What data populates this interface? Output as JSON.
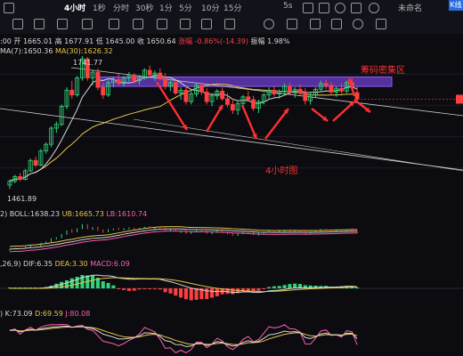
{
  "toolbar": {
    "timeframes": [
      "4小时",
      "1秒",
      "分时",
      "30秒",
      "1分",
      "5分",
      "10分",
      "15分"
    ],
    "active_timeframe": "4小时",
    "refresh_label": "5s",
    "account_label": "未命名",
    "k_label": "K线"
  },
  "ohlc_row": {
    "open_text": ":00 开 1665.01",
    "high_text": "高 1677.91",
    "low_text": "低 1645.00",
    "close_text": "收 1650.64",
    "change_text": "涨幅 -0.86%(-14.39)",
    "amplitude_text": "振幅 1.98%"
  },
  "ma_row": {
    "ma7_text": "MA(7):1650.36",
    "ma30_text": "MA(30):1626.32"
  },
  "boll_row": {
    "prefix": "2)",
    "boll_text": "BOLL:1638.23",
    "ub_text": "UB:1665.73",
    "lb_text": "LB:1610.74"
  },
  "macd_row": {
    "prefix": ",26,9)",
    "dif_text": "DIF:6.35",
    "dea_text": "DEA:3.30",
    "macd_text": "MACD:6.09"
  },
  "kdj_row": {
    "prefix": ")",
    "k_text": "K:73.09",
    "d_text": "D:69.59",
    "j_text": "J:80.08"
  },
  "annotations": {
    "high_marker": "1741.77",
    "low_marker": "1461.89",
    "zone_label": "筹码密集区",
    "timeframe_label": "4小时图"
  },
  "colors": {
    "up": "#33d17a",
    "down": "#ff4040",
    "ma7": "#d8d8d8",
    "ma30": "#e8c547",
    "zone": "#6f3fd0",
    "annotation": "#ff3030"
  },
  "chart_data": {
    "type": "candlestick",
    "symbol_interval": "4小时",
    "y_range": [
      1440,
      1770
    ],
    "candles": [
      [
        1470,
        1482,
        1462,
        1478
      ],
      [
        1478,
        1492,
        1474,
        1488
      ],
      [
        1488,
        1496,
        1478,
        1482
      ],
      [
        1482,
        1504,
        1480,
        1500
      ],
      [
        1500,
        1526,
        1498,
        1522
      ],
      [
        1522,
        1530,
        1508,
        1512
      ],
      [
        1512,
        1546,
        1510,
        1542
      ],
      [
        1542,
        1560,
        1536,
        1556
      ],
      [
        1556,
        1594,
        1550,
        1590
      ],
      [
        1590,
        1604,
        1580,
        1598
      ],
      [
        1598,
        1640,
        1594,
        1636
      ],
      [
        1636,
        1676,
        1630,
        1670
      ],
      [
        1670,
        1690,
        1652,
        1660
      ],
      [
        1660,
        1700,
        1656,
        1696
      ],
      [
        1696,
        1742,
        1690,
        1736
      ],
      [
        1736,
        1740,
        1690,
        1696
      ],
      [
        1696,
        1712,
        1680,
        1708
      ],
      [
        1708,
        1716,
        1670,
        1676
      ],
      [
        1676,
        1686,
        1652,
        1660
      ],
      [
        1660,
        1690,
        1656,
        1686
      ],
      [
        1686,
        1698,
        1676,
        1692
      ],
      [
        1692,
        1704,
        1680,
        1684
      ],
      [
        1684,
        1700,
        1678,
        1696
      ],
      [
        1696,
        1708,
        1688,
        1702
      ],
      [
        1702,
        1706,
        1684,
        1690
      ],
      [
        1690,
        1702,
        1682,
        1698
      ],
      [
        1698,
        1716,
        1692,
        1712
      ],
      [
        1712,
        1722,
        1698,
        1702
      ],
      [
        1702,
        1712,
        1690,
        1706
      ],
      [
        1706,
        1716,
        1690,
        1694
      ],
      [
        1694,
        1706,
        1672,
        1678
      ],
      [
        1678,
        1690,
        1668,
        1686
      ],
      [
        1686,
        1692,
        1660,
        1664
      ],
      [
        1664,
        1676,
        1650,
        1670
      ],
      [
        1670,
        1680,
        1640,
        1646
      ],
      [
        1646,
        1668,
        1640,
        1662
      ],
      [
        1662,
        1684,
        1656,
        1680
      ],
      [
        1680,
        1686,
        1660,
        1666
      ],
      [
        1666,
        1674,
        1640,
        1646
      ],
      [
        1646,
        1664,
        1636,
        1658
      ],
      [
        1658,
        1672,
        1650,
        1668
      ],
      [
        1668,
        1676,
        1648,
        1652
      ],
      [
        1652,
        1664,
        1634,
        1640
      ],
      [
        1640,
        1652,
        1620,
        1628
      ],
      [
        1628,
        1646,
        1618,
        1642
      ],
      [
        1642,
        1660,
        1636,
        1656
      ],
      [
        1656,
        1668,
        1646,
        1650
      ],
      [
        1650,
        1658,
        1626,
        1632
      ],
      [
        1632,
        1650,
        1622,
        1646
      ],
      [
        1646,
        1664,
        1640,
        1660
      ],
      [
        1660,
        1676,
        1652,
        1670
      ],
      [
        1670,
        1680,
        1656,
        1662
      ],
      [
        1662,
        1672,
        1652,
        1668
      ],
      [
        1668,
        1684,
        1660,
        1678
      ],
      [
        1678,
        1686,
        1662,
        1666
      ],
      [
        1666,
        1676,
        1654,
        1672
      ],
      [
        1672,
        1682,
        1660,
        1664
      ],
      [
        1664,
        1674,
        1640,
        1648
      ],
      [
        1648,
        1664,
        1640,
        1660
      ],
      [
        1660,
        1676,
        1654,
        1672
      ],
      [
        1672,
        1690,
        1666,
        1684
      ],
      [
        1684,
        1692,
        1672,
        1680
      ],
      [
        1680,
        1686,
        1660,
        1666
      ],
      [
        1666,
        1678,
        1656,
        1674
      ],
      [
        1674,
        1684,
        1662,
        1668
      ],
      [
        1668,
        1690,
        1664,
        1686
      ],
      [
        1686,
        1698,
        1676,
        1680
      ],
      [
        1665,
        1678,
        1645,
        1651
      ]
    ],
    "ma7_label": "MA(7)",
    "ma30_label": "MA(30)",
    "zone_low": 1678,
    "zone_high": 1698
  }
}
